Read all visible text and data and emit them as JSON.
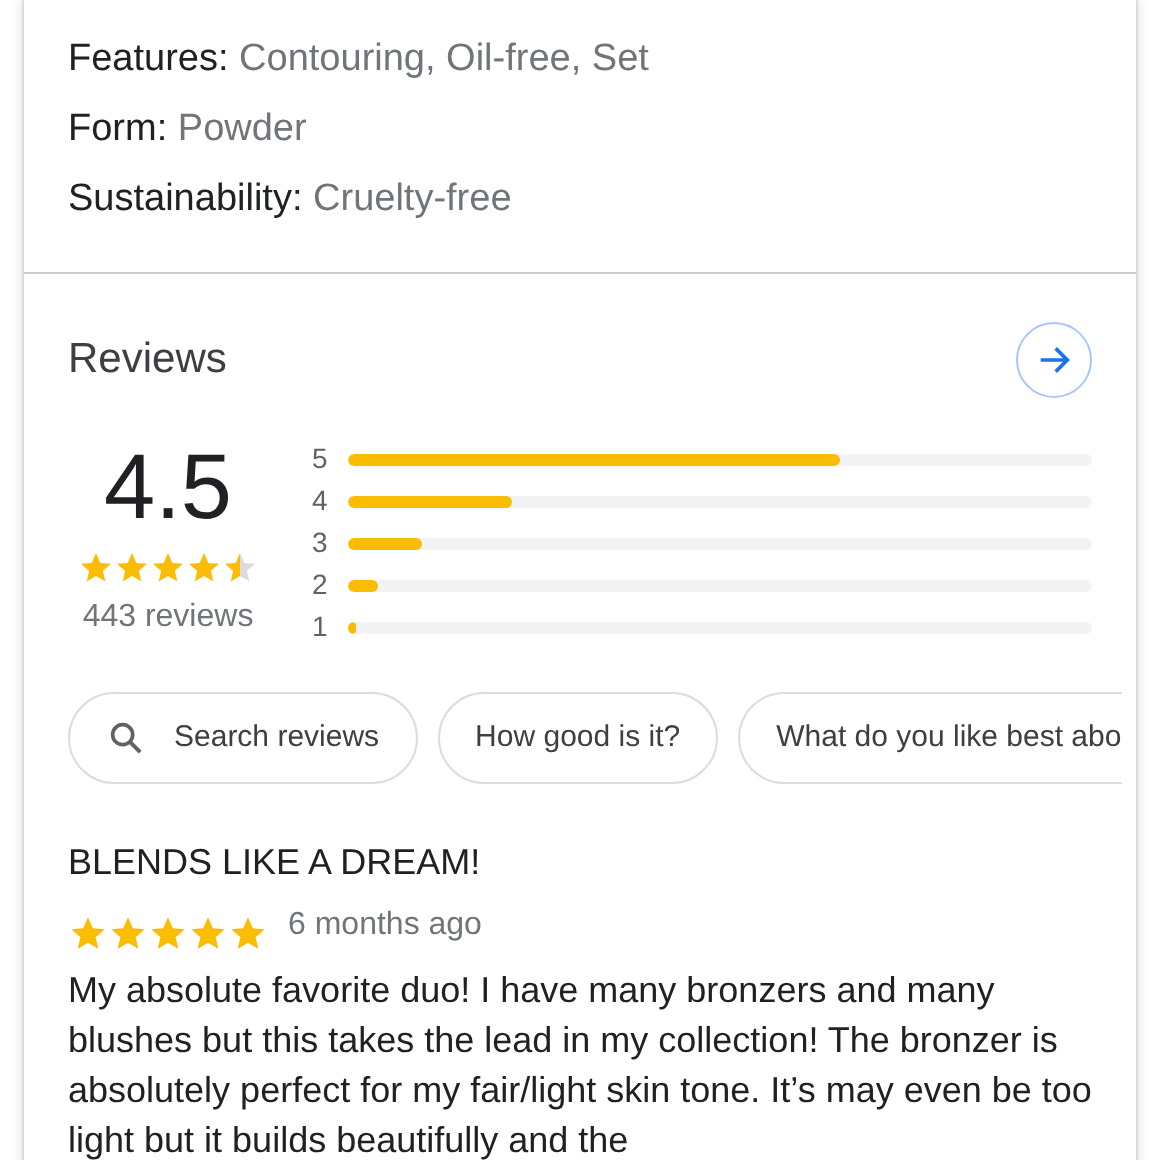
{
  "attributes": [
    {
      "label": "Features:",
      "value": "Contouring, Oil-free, Set"
    },
    {
      "label": "Form:",
      "value": "Powder"
    },
    {
      "label": "Sustainability:",
      "value": "Cruelty-free"
    }
  ],
  "reviews": {
    "title": "Reviews",
    "rating": "4.5",
    "stars": 4.5,
    "count": "443 reviews",
    "histogram": [
      {
        "label": "5",
        "level": 0.66
      },
      {
        "label": "4",
        "level": 0.22
      },
      {
        "label": "3",
        "level": 0.1
      },
      {
        "label": "2",
        "level": 0.04
      },
      {
        "label": "1",
        "level": 0.01
      }
    ],
    "chips": [
      {
        "kind": "search",
        "label": "Search reviews"
      },
      {
        "kind": "question",
        "label": "How good is it?"
      },
      {
        "kind": "question",
        "label": "What do you like best abo"
      }
    ],
    "review": {
      "title": "BLENDS LIKE A DREAM!",
      "stars": 5,
      "time": "6 months ago",
      "body": "My absolute favorite duo! I have many bronzers and many blushes but this takes the lead in my collection! The bronzer is absolutely perfect for my fair/light skin tone. It’s may even be too light but it builds beautifully and the"
    }
  }
}
